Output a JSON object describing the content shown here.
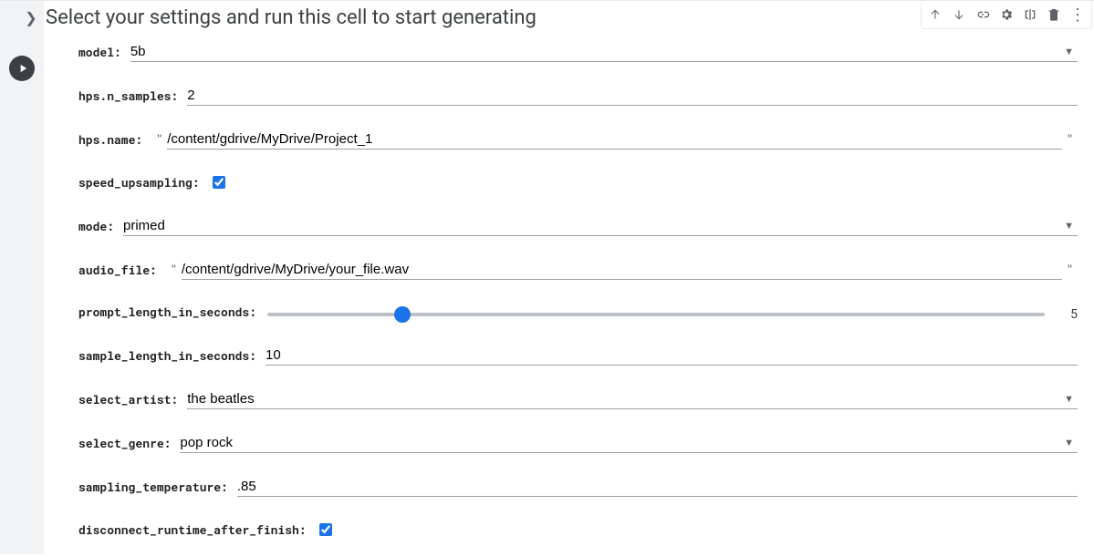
{
  "title": "Select your settings and run this cell to start generating",
  "form": {
    "model": {
      "label": "model:",
      "value": "5b"
    },
    "n_samples": {
      "label": "hps.n_samples:",
      "value": "2"
    },
    "name": {
      "label": "hps.name:",
      "value": "/content/gdrive/MyDrive/Project_1"
    },
    "speed_upsampling": {
      "label": "speed_upsampling:",
      "value": true
    },
    "mode": {
      "label": "mode:",
      "value": "primed"
    },
    "audio_file": {
      "label": "audio_file:",
      "value": "/content/gdrive/MyDrive/your_file.wav"
    },
    "prompt_length": {
      "label": "prompt_length_in_seconds:",
      "value": "5",
      "min": "0",
      "max": "30"
    },
    "sample_length": {
      "label": "sample_length_in_seconds:",
      "value": "10"
    },
    "select_artist": {
      "label": "select_artist:",
      "value": "the beatles"
    },
    "select_genre": {
      "label": "select_genre:",
      "value": "pop rock"
    },
    "sampling_temperature": {
      "label": "sampling_temperature:",
      "value": ".85"
    },
    "disconnect": {
      "label": "disconnect_runtime_after_finish:",
      "value": true
    }
  }
}
